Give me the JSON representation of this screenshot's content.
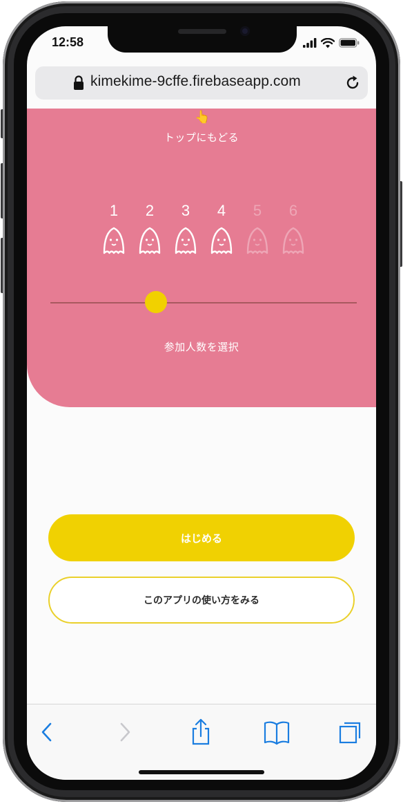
{
  "status_bar": {
    "time": "12:58",
    "icons": [
      "signal-icon",
      "wifi-icon",
      "battery-icon"
    ]
  },
  "browser": {
    "url": "kimekime-9cffe.firebaseapp.com",
    "icons": [
      "lock-icon",
      "reload-icon"
    ]
  },
  "hero": {
    "pointer_glyph": "👆",
    "back_link_label": "トップにもどる",
    "participants": [
      {
        "label": "1",
        "active": true
      },
      {
        "label": "2",
        "active": true
      },
      {
        "label": "3",
        "active": true
      },
      {
        "label": "4",
        "active": true
      },
      {
        "label": "5",
        "active": false
      },
      {
        "label": "6",
        "active": false
      }
    ],
    "slider": {
      "min": 1,
      "max": 6,
      "value": 4,
      "label": "参加人数を選択"
    }
  },
  "actions": {
    "start_label": "はじめる",
    "howto_label": "このアプリの使い方をみる"
  },
  "toolbar": {
    "items": [
      "back-arrow-icon",
      "forward-arrow-icon",
      "share-icon",
      "bookmarks-icon",
      "tabs-icon"
    ]
  },
  "colors": {
    "pink": "#e67c93",
    "yellow": "#f0d102",
    "ios_blue": "#1a7de0"
  }
}
